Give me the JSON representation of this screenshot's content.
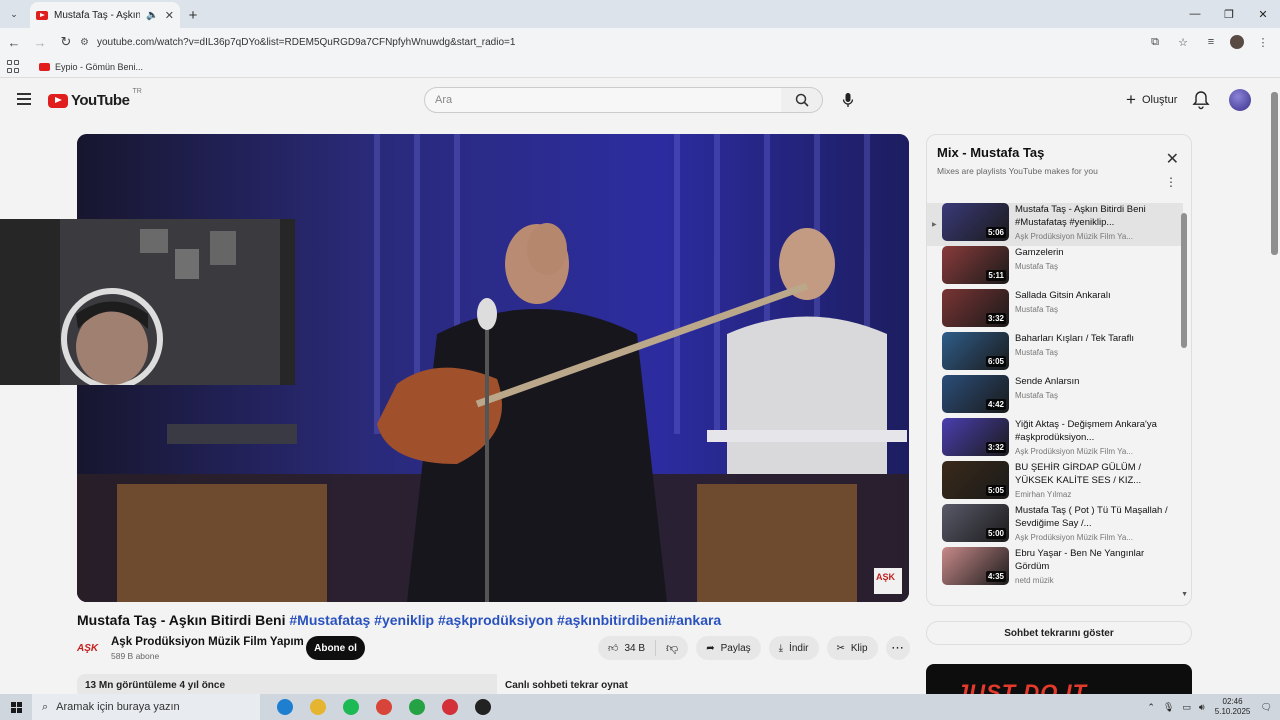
{
  "browser": {
    "tab_title": "Mustafa Taş - Aşkın Bitirdi B",
    "new_tab_label": "+",
    "url": "youtube.com/watch?v=dIL36p7qDYo&list=RDEM5QuRGD9a7CFNpfyhWnuwdg&start_radio=1",
    "bookmark_label": "Eypio - Gömün Beni..."
  },
  "youtube": {
    "logo_text": "YouTube",
    "region": "TR",
    "search_placeholder": "Ara",
    "create_label": "Oluştur"
  },
  "video": {
    "title_main": "Mustafa Taş - Aşkın Bitirdi Beni ",
    "title_tags": "#Mustafataş #yeniklip #aşkprodüksiyon  #aşkınbitirdibeni#ankara",
    "channel_name": "Aşk Prodüksiyon Müzik Film Yapım",
    "channel_logo": "AŞK",
    "subscribers": "589 B abone",
    "subscribe_label": "Abone ol",
    "likes": "34 B",
    "share_label": "Paylaş",
    "download_label": "İndir",
    "clip_label": "Klip",
    "views_date": "13 Mn görüntüleme  4 yıl önce",
    "live_chat_replay": "Canlı sohbeti tekrar oynat"
  },
  "mix": {
    "title": "Mix - Mustafa Taş",
    "subtitle": "Mixes are playlists YouTube makes for you",
    "show_chat_label": "Sohbet tekrarını göster",
    "items": [
      {
        "title": "Mustafa Taş - Aşkın Bitirdi Beni #Mustafataş #yeniklip...",
        "channel": "Aşk Prodüksiyon Müzik Film Ya...",
        "duration": "5:06",
        "color": "#3a3a7a"
      },
      {
        "title": "Gamzelerin",
        "channel": "Mustafa Taş",
        "duration": "5:11",
        "color": "#8a3b3b"
      },
      {
        "title": "Sallada Gitsin Ankaralı",
        "channel": "Mustafa Taş",
        "duration": "3:32",
        "color": "#7a3434"
      },
      {
        "title": "Baharları Kışları / Tek Taraflı",
        "channel": "Mustafa Taş",
        "duration": "6:05",
        "color": "#2f5d8a"
      },
      {
        "title": "Sende Anlarsın",
        "channel": "Mustafa Taş",
        "duration": "4:42",
        "color": "#2b4e7a"
      },
      {
        "title": "Yiğit Aktaş - Değişmem Ankara'ya #aşkprodüksiyon...",
        "channel": "Aşk Prodüksiyon Müzik Film Ya...",
        "duration": "3:32",
        "color": "#4a3fb0"
      },
      {
        "title": "BU ŞEHİR GİRDAP GÜLÜM / YÜKSEK KALİTE SES / KIZ...",
        "channel": "Emirhan Yılmaz",
        "duration": "5:05",
        "color": "#3a2a1a"
      },
      {
        "title": "Mustafa Taş ( Pot ) Tü Tü Maşallah / Sevdiğime Say /...",
        "channel": "Aşk Prodüksiyon Müzik Film Ya...",
        "duration": "5:00",
        "color": "#5a5a6a"
      },
      {
        "title": "Ebru Yaşar - Ben Ne Yangınlar Gördüm",
        "channel": "netd müzik",
        "duration": "4:35",
        "color": "#c98a8a"
      }
    ]
  },
  "ad": {
    "text": "JUST DO IT"
  },
  "taskbar": {
    "search_placeholder": "Aramak için buraya yazın",
    "time": "02:46",
    "date": "5.10.2025",
    "apps": [
      {
        "name": "edge",
        "color": "#1e7fd0"
      },
      {
        "name": "file-explorer",
        "color": "#e6b530"
      },
      {
        "name": "spotify",
        "color": "#1db954"
      },
      {
        "name": "chrome",
        "color": "#d9443a"
      },
      {
        "name": "whatsapp",
        "color": "#25a244"
      },
      {
        "name": "opera",
        "color": "#d3303a"
      },
      {
        "name": "obs",
        "color": "#222222"
      }
    ]
  },
  "colors": {
    "youtube_red": "#e01e1e",
    "hashtag_blue": "#2a52be"
  }
}
